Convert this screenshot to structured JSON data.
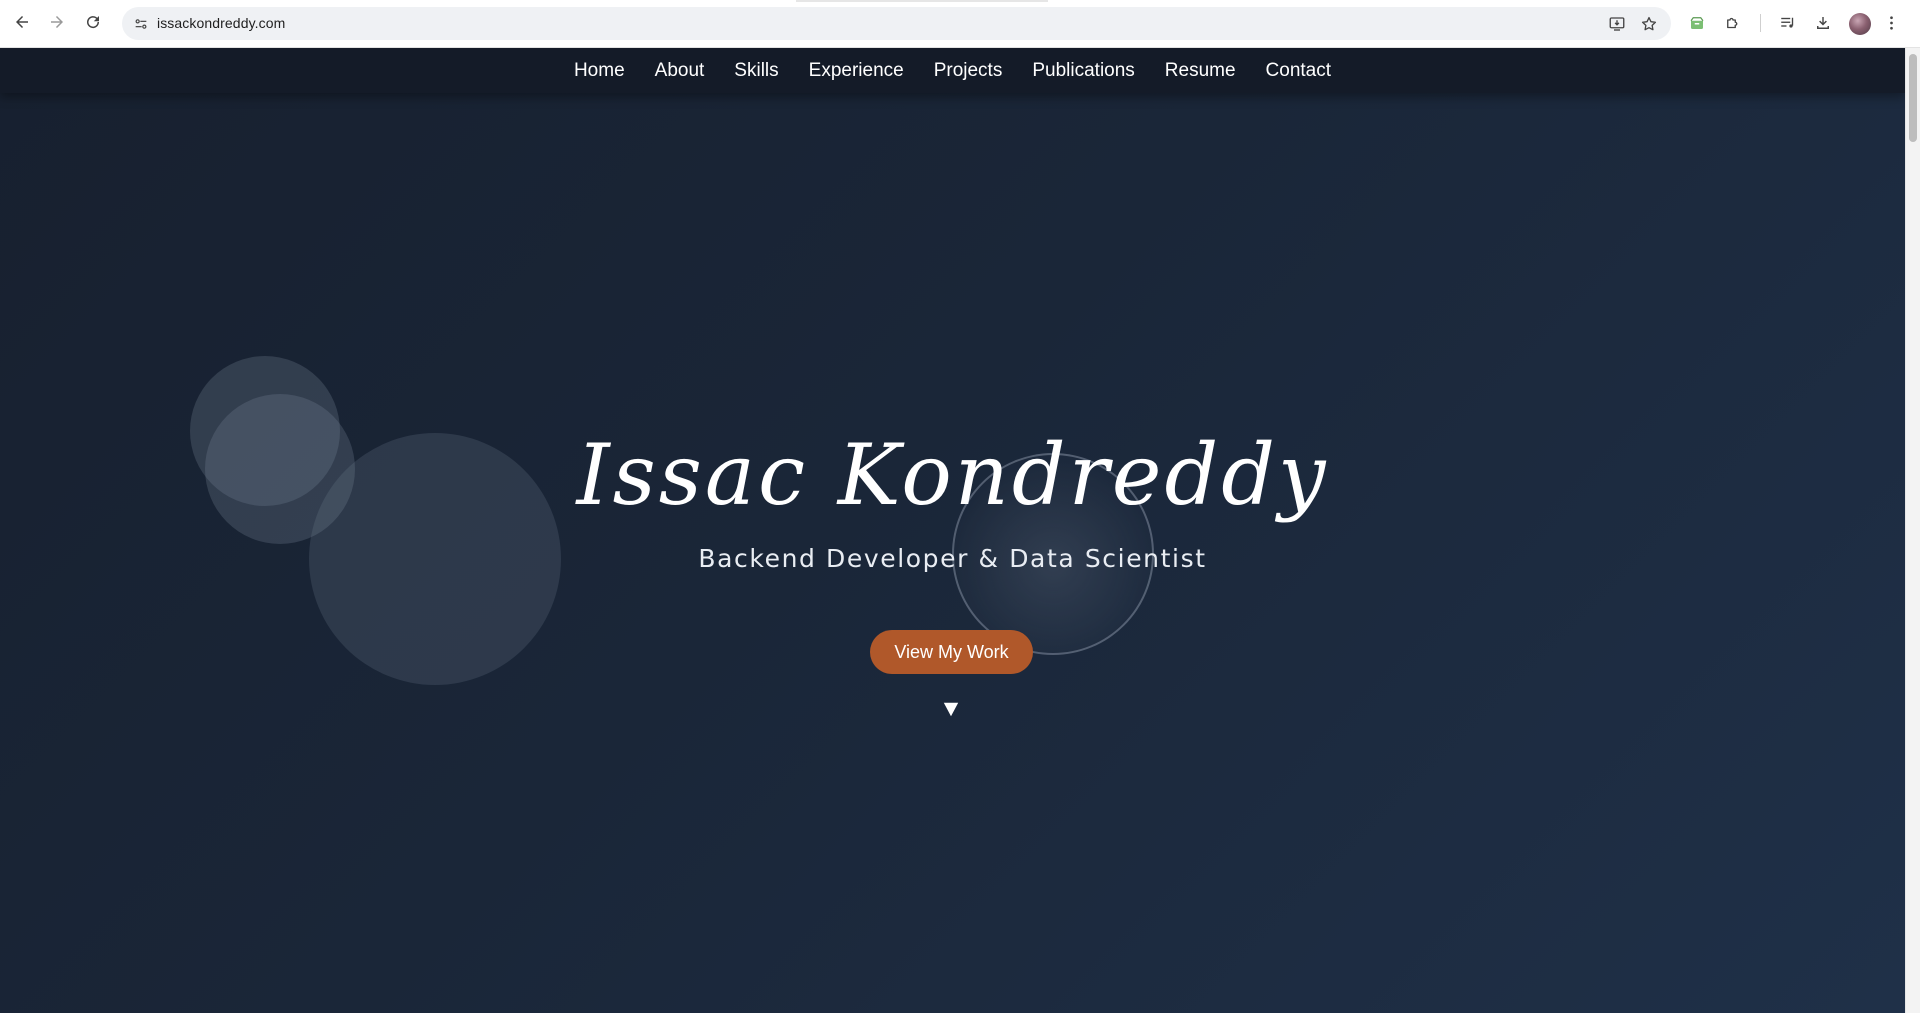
{
  "browser": {
    "url": "issackondreddy.com",
    "icons": {
      "back": "back-arrow-icon",
      "forward": "forward-arrow-icon",
      "reload": "reload-icon",
      "site_info": "site-settings-icon",
      "install": "install-app-icon",
      "bookmark": "star-icon",
      "extension_1": "extension-icon",
      "extensions": "puzzle-icon",
      "reading_list": "media-queue-icon",
      "downloads": "download-icon",
      "profile": "avatar",
      "menu": "kebab-menu-icon"
    }
  },
  "nav": {
    "items": [
      {
        "label": "Home"
      },
      {
        "label": "About"
      },
      {
        "label": "Skills"
      },
      {
        "label": "Experience"
      },
      {
        "label": "Projects"
      },
      {
        "label": "Publications"
      },
      {
        "label": "Resume"
      },
      {
        "label": "Contact"
      }
    ]
  },
  "hero": {
    "name": "Issac Kondreddy",
    "subtitle": "Backend Developer & Data Scientist",
    "cta_label": "View My Work",
    "scroll_glyph": "▼"
  },
  "colors": {
    "background_start": "#17202f",
    "background_end": "#1f3048",
    "nav_background": "#141b28",
    "accent": "#b0582a"
  }
}
